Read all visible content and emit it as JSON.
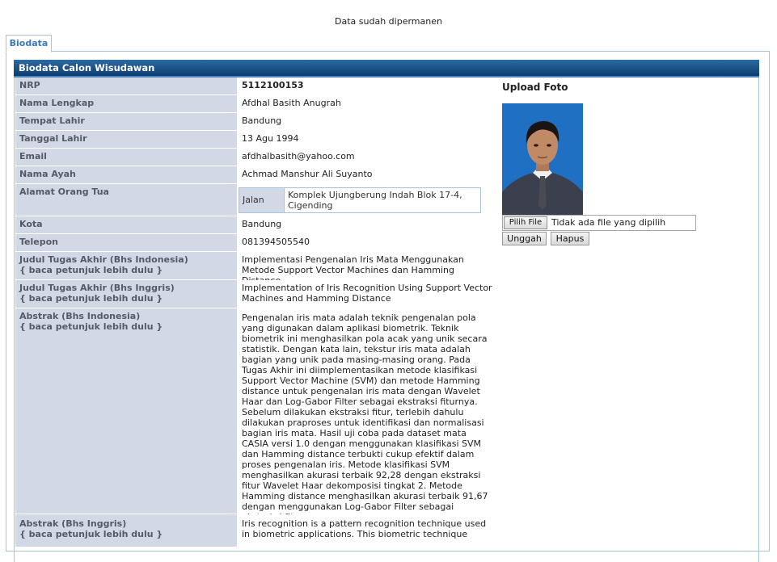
{
  "status_message": "Data sudah dipermanen",
  "tab": {
    "label": "Biodata"
  },
  "section_title": "Biodata Calon Wisudawan",
  "fields": {
    "nrp": {
      "label": "NRP",
      "value": "5112100153"
    },
    "nama_lengkap": {
      "label": "Nama Lengkap",
      "value": "Afdhal Basith Anugrah"
    },
    "tempat_lahir": {
      "label": "Tempat Lahir",
      "value": "Bandung"
    },
    "tanggal_lahir": {
      "label": "Tanggal Lahir",
      "value": "13 Agu 1994"
    },
    "email": {
      "label": "Email",
      "value": "afdhalbasith@yahoo.com"
    },
    "nama_ayah": {
      "label": "Nama Ayah",
      "value": "Achmad Manshur Ali Suyanto"
    },
    "alamat": {
      "label": "Alamat Orang Tua",
      "sub_label": "Jalan",
      "value": "Komplek Ujungberung Indah Blok 17-4, Cigending"
    },
    "kota": {
      "label": "Kota",
      "value": "Bandung"
    },
    "telepon": {
      "label": "Telepon",
      "value": "081394505540"
    },
    "judul_id": {
      "label": "Judul Tugas Akhir (Bhs Indonesia)",
      "hint": "{ baca petunjuk lebih dulu }",
      "value": "Implementasi Pengenalan Iris Mata Menggunakan Metode Support Vector Machines dan Hamming Distance"
    },
    "judul_en": {
      "label": "Judul Tugas Akhir (Bhs Inggris)",
      "hint": "{ baca petunjuk lebih dulu }",
      "value": "Implementation of Iris Recognition Using Support Vector Machines and Hamming Distance"
    },
    "abstrak_id": {
      "label": "Abstrak (Bhs Indonesia)",
      "hint": "{ baca petunjuk lebih dulu }",
      "value": "Pengenalan iris mata adalah teknik pengenalan pola yang digunakan dalam aplikasi biometrik. Teknik biometrik ini menghasilkan pola acak yang unik secara statistik. Dengan kata lain, tekstur iris mata adalah bagian yang unik pada masing-masing orang. Pada Tugas Akhir ini diimplementasikan metode klasifikasi Support Vector Machine (SVM) dan metode Hamming distance untuk pengenalan iris mata dengan Wavelet Haar dan Log-Gabor Filter sebagai ekstraksi fiturnya. Sebelum dilakukan ekstraksi fitur, terlebih dahulu dilakukan praproses untuk identifikasi dan normalisasi bagian iris mata. Hasil uji coba pada dataset mata CASIA versi 1.0 dengan menggunakan klasifikasi SVM dan Hamming distance terbukti cukup efektif dalam proses pengenalan iris. Metode klasifikasi SVM menghasilkan akurasi terbaik 92,28 dengan ekstraksi fitur Wavelet Haar dekomposisi tingkat 2. Metode Hamming distance menghasilkan akurasi terbaik 91,67 dengan menggunakan Log-Gabor Filter sebagai ekstraksi fiturnya."
    },
    "abstrak_en": {
      "label": "Abstrak (Bhs Inggris)",
      "hint": "{ baca petunjuk lebih dulu }",
      "value": "Iris recognition is a pattern recognition technique used in biometric applications. This biometric technique"
    }
  },
  "upload": {
    "title": "Upload Foto",
    "choose_button": "Pilih File",
    "no_file_text": "Tidak ada file yang dipilih",
    "upload_button": "Unggah",
    "delete_button": "Hapus"
  },
  "colors": {
    "header_bg": "#1a4f86",
    "label_bg": "#d2d8e6",
    "tab_text": "#3a7ab8",
    "border": "#a8c4dc"
  }
}
